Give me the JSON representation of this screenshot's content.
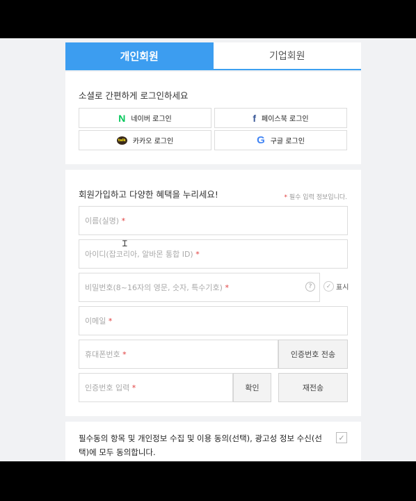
{
  "tabs": {
    "personal": "개인회원",
    "business": "기업회원"
  },
  "social": {
    "title": "소셜로 간편하게 로그인하세요",
    "naver": {
      "label": "네이버 로그인",
      "icon": "naver-icon",
      "glyph": "N"
    },
    "facebook": {
      "label": "페이스북 로그인",
      "icon": "facebook-icon",
      "glyph": "f"
    },
    "kakao": {
      "label": "카카오 로그인",
      "icon": "kakao-icon",
      "glyph": "talk"
    },
    "google": {
      "label": "구글 로그인",
      "icon": "google-icon",
      "glyph": "G"
    }
  },
  "signup": {
    "title": "회원가입하고 다양한 혜택을 누리세요!",
    "required_note": "필수 입력 정보입니다.",
    "required_mark": "*",
    "name_placeholder": "이름(실명)",
    "id_placeholder": "아이디(잡코리아, 알바몬 통합 ID)",
    "password_placeholder": "비밀번호(8~16자의 영문, 숫자, 특수기호)",
    "password_help_glyph": "?",
    "show_label": "표시",
    "email_placeholder": "이메일",
    "phone_placeholder": "휴대폰번호",
    "send_code_button": "인증번호 전송",
    "code_placeholder": "인증번호 입력",
    "confirm_button": "확인",
    "resend_button": "재전송"
  },
  "agree": {
    "text": "필수동의 항목 및 개인정보 수집 및 이용 동의(선택), 광고성 정보 수신(선택)에 모두 동의합니다."
  },
  "colors": {
    "accent": "#3c9df0",
    "required": "#e03b3b",
    "naver": "#03c75a",
    "facebook": "#3b5998"
  }
}
